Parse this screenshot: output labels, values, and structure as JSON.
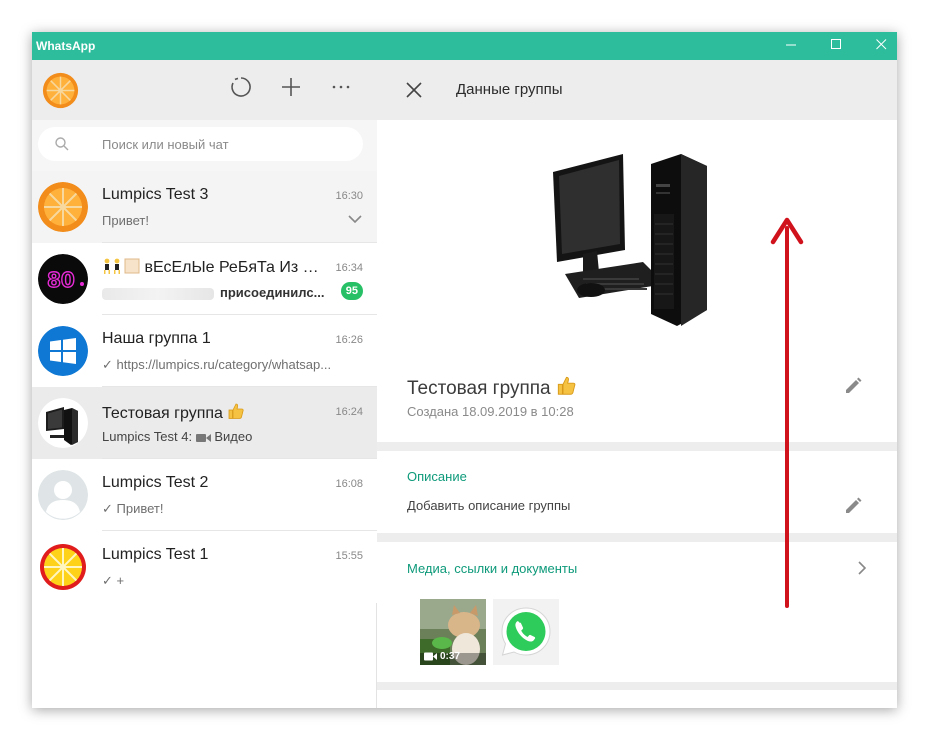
{
  "window": {
    "title": "WhatsApp",
    "minimize": "—",
    "maximize": "☐",
    "close": "✕"
  },
  "left": {
    "search": {
      "placeholder": "Поиск или новый чат"
    },
    "chats": [
      {
        "name": "Lumpics Test 3",
        "time": "16:30",
        "preview": "Привет!"
      },
      {
        "name": "вЕсЕлЫе РеБяТа Из 8...",
        "time": "16:34",
        "preview": "присоединилс...",
        "badge": "95"
      },
      {
        "name": "Наша группа 1",
        "time": "16:26",
        "preview": "✓ https://lumpics.ru/category/whatsap..."
      },
      {
        "name": "Тестовая группа",
        "time": "16:24",
        "preview_prefix": "Lumpics Test 4:",
        "preview": "Видео"
      },
      {
        "name": "Lumpics Test 2",
        "time": "16:08",
        "preview": "✓ Привет!"
      },
      {
        "name": "Lumpics Test 1",
        "time": "15:55",
        "preview": "✓ +"
      }
    ]
  },
  "right": {
    "title": "Данные группы",
    "group_name": "Тестовая группа",
    "created": "Создана 18.09.2019 в 10:28",
    "description_title": "Описание",
    "description_placeholder": "Добавить описание группы",
    "media_title": "Медиа, ссылки и документы",
    "video_duration": "0:37"
  },
  "colors": {
    "titlebar": "#2ebd9c",
    "accent": "#0e9a7a",
    "badge": "#27c066",
    "arrow": "#d0121c"
  }
}
